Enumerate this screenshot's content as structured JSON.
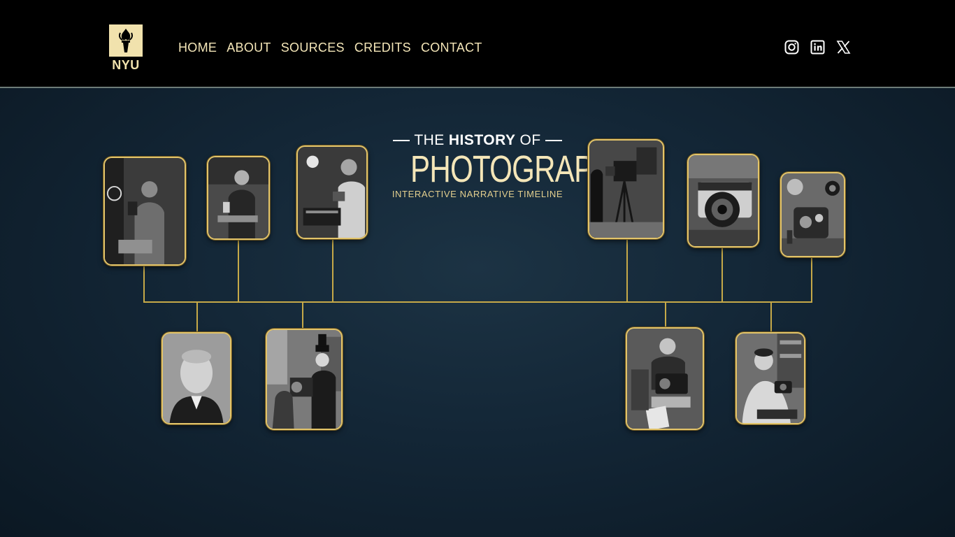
{
  "brand": {
    "logo_text": "NYU"
  },
  "nav": {
    "items": [
      "HOME",
      "ABOUT",
      "SOURCES",
      "CREDITS",
      "CONTACT"
    ]
  },
  "social": [
    "instagram-icon",
    "linkedin-icon",
    "x-icon"
  ],
  "title": {
    "pre": "THE",
    "highlight": "HISTORY",
    "post": "OF",
    "main": "PHOTOGRAPHY",
    "subtitle": "INTERACTIVE NARRATIVE TIMELINE"
  },
  "timeline": {
    "top_cards": [
      "camera-obscura-scholar",
      "early-chemist-experiment",
      "victorian-photographer-desk",
      "studio-bellows-camera",
      "rangefinder-camera",
      "digital-smartphone-camera"
    ],
    "bottom_cards": [
      "portrait-niepce",
      "street-box-camera",
      "instant-polaroid-camera",
      "smiling-photographer"
    ]
  },
  "colors": {
    "accent": "#f4e6b8",
    "frame_gold": "#e2c46a",
    "background": "#132636"
  }
}
